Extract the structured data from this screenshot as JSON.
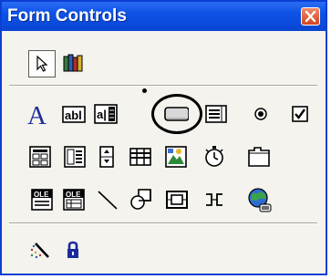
{
  "window": {
    "title": "Form Controls",
    "title_bar_color": "#0d52e6",
    "close_button_color": "#d2451e"
  },
  "toolbar": {
    "rows": [
      [
        "select-objects-icon",
        "more-controls-icon"
      ],
      [
        "label-icon",
        "edit-box-icon",
        "combination-edit-box-icon",
        "button-icon",
        "combination-list-edit-icon",
        "option-button-icon",
        "check-box-icon"
      ],
      [
        "group-box-icon",
        "list-box-icon",
        "spinner-icon",
        "scroll-bar-icon",
        "combo-box-icon",
        "run-dialog-icon",
        "tab-control-icon"
      ],
      [
        "ole-object-icon",
        "ole-list-icon",
        "line-icon",
        "shapes-icon",
        "rectangle-frame-icon",
        "connector-icon",
        "web-browser-icon"
      ],
      [
        "toggle-grid-icon",
        "lock-icon"
      ]
    ],
    "selected_tool": "select-objects-icon",
    "highlighted_tool": "button-icon"
  },
  "labels": {
    "label_tool_letter": "A",
    "edit_box_text": "abl",
    "combo_edit_text": "a|",
    "ole_text": "OLE"
  }
}
